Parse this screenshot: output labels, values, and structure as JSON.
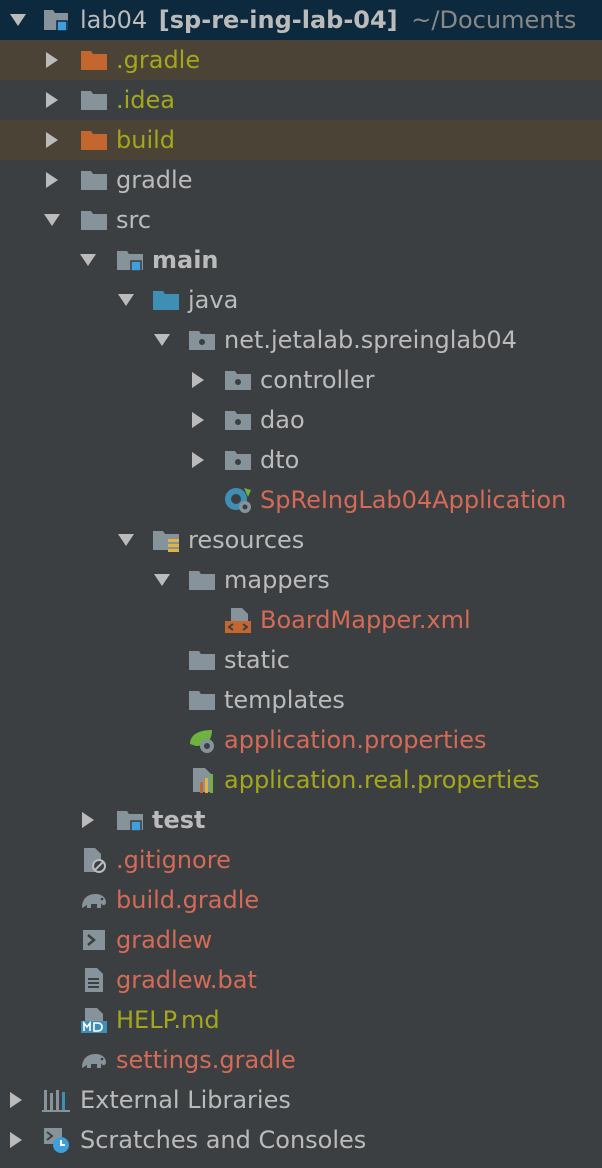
{
  "colors": {
    "background": "#3c3f41",
    "selected_row": "#0d293e",
    "excluded_row": "#4a4336",
    "text": "#bbbbbb",
    "modified_red": "#d56a56",
    "unversioned_olive": "#a5a71b",
    "folder_gray": "#87939a",
    "folder_orange": "#c4672f",
    "source_blue": "#3f8fb5"
  },
  "root": {
    "name": "lab04",
    "module": "[sp-re-ing-lab-04]",
    "path": "~/Documents",
    "icon": "module-folder-icon",
    "expanded": true
  },
  "items": [
    {
      "label": ".gradle",
      "icon": "excluded-folder-icon",
      "status": "excluded",
      "expanded": false
    },
    {
      "label": ".idea",
      "icon": "folder-icon",
      "status": "unversioned",
      "expanded": false
    },
    {
      "label": "build",
      "icon": "excluded-folder-icon",
      "status": "excluded",
      "expanded": false
    },
    {
      "label": "gradle",
      "icon": "folder-icon",
      "status": "normal",
      "expanded": false
    },
    {
      "label": "src",
      "icon": "folder-icon",
      "status": "normal",
      "expanded": true
    },
    {
      "label": "main",
      "icon": "module-folder-icon",
      "status": "normal",
      "expanded": true
    },
    {
      "label": "java",
      "icon": "source-root-icon",
      "status": "normal",
      "expanded": true
    },
    {
      "label": "net.jetalab.spreinglab04",
      "icon": "package-icon",
      "status": "normal",
      "expanded": true
    },
    {
      "label": "controller",
      "icon": "package-icon",
      "status": "normal",
      "expanded": false
    },
    {
      "label": "dao",
      "icon": "package-icon",
      "status": "normal",
      "expanded": false
    },
    {
      "label": "dto",
      "icon": "package-icon",
      "status": "normal",
      "expanded": false
    },
    {
      "label": "SpReIngLab04Application",
      "icon": "spring-boot-class-icon",
      "status": "unversioned"
    },
    {
      "label": "resources",
      "icon": "resources-root-icon",
      "status": "normal",
      "expanded": true
    },
    {
      "label": "mappers",
      "icon": "folder-icon",
      "status": "normal",
      "expanded": true
    },
    {
      "label": "BoardMapper.xml",
      "icon": "xml-file-icon",
      "status": "unversioned"
    },
    {
      "label": "static",
      "icon": "folder-icon",
      "status": "normal"
    },
    {
      "label": "templates",
      "icon": "folder-icon",
      "status": "normal"
    },
    {
      "label": "application.properties",
      "icon": "spring-properties-icon",
      "status": "unversioned"
    },
    {
      "label": "application.real.properties",
      "icon": "properties-file-icon",
      "status": "ignored"
    },
    {
      "label": "test",
      "icon": "module-folder-icon",
      "status": "normal",
      "expanded": false
    },
    {
      "label": ".gitignore",
      "icon": "ignore-file-icon",
      "status": "unversioned"
    },
    {
      "label": "build.gradle",
      "icon": "gradle-icon",
      "status": "unversioned"
    },
    {
      "label": "gradlew",
      "icon": "shell-script-icon",
      "status": "unversioned"
    },
    {
      "label": "gradlew.bat",
      "icon": "text-file-icon",
      "status": "unversioned"
    },
    {
      "label": "HELP.md",
      "icon": "markdown-icon",
      "status": "ignored"
    },
    {
      "label": "settings.gradle",
      "icon": "gradle-icon",
      "status": "unversioned"
    },
    {
      "label": "External Libraries",
      "icon": "external-libraries-icon",
      "status": "normal",
      "expanded": false
    },
    {
      "label": "Scratches and Consoles",
      "icon": "scratches-icon",
      "status": "normal",
      "expanded": false
    }
  ]
}
